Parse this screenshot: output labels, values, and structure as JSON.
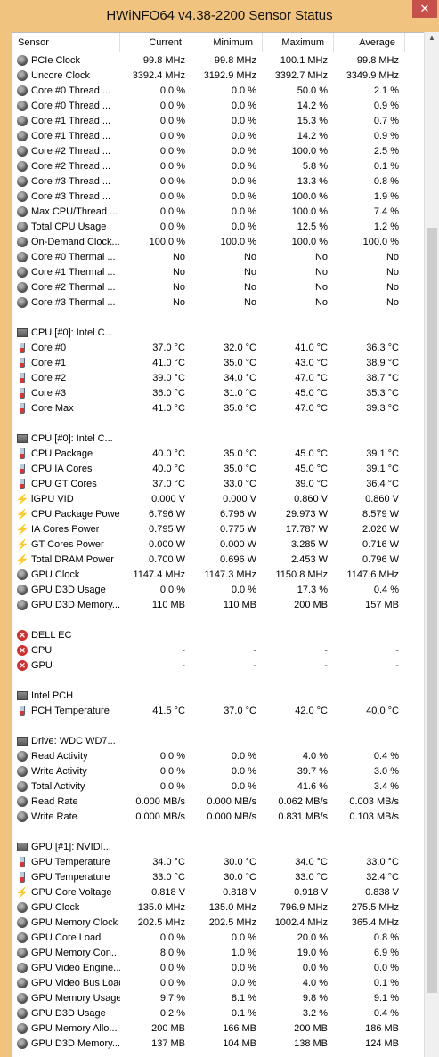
{
  "window": {
    "title": "HWiNFO64 v4.38-2200 Sensor Status",
    "close_label": "✕"
  },
  "columns": {
    "sensor": "Sensor",
    "current": "Current",
    "minimum": "Minimum",
    "maximum": "Maximum",
    "average": "Average"
  },
  "rows": [
    {
      "type": "row",
      "icon": "gauge",
      "name": "PCIe Clock",
      "cur": "99.8 MHz",
      "min": "99.8 MHz",
      "max": "100.1 MHz",
      "avg": "99.8 MHz"
    },
    {
      "type": "row",
      "icon": "gauge",
      "name": "Uncore Clock",
      "cur": "3392.4 MHz",
      "min": "3192.9 MHz",
      "max": "3392.7 MHz",
      "avg": "3349.9 MHz"
    },
    {
      "type": "row",
      "icon": "gauge",
      "name": "Core #0 Thread ...",
      "cur": "0.0 %",
      "min": "0.0 %",
      "max": "50.0 %",
      "avg": "2.1 %"
    },
    {
      "type": "row",
      "icon": "gauge",
      "name": "Core #0 Thread ...",
      "cur": "0.0 %",
      "min": "0.0 %",
      "max": "14.2 %",
      "avg": "0.9 %"
    },
    {
      "type": "row",
      "icon": "gauge",
      "name": "Core #1 Thread ...",
      "cur": "0.0 %",
      "min": "0.0 %",
      "max": "15.3 %",
      "avg": "0.7 %"
    },
    {
      "type": "row",
      "icon": "gauge",
      "name": "Core #1 Thread ...",
      "cur": "0.0 %",
      "min": "0.0 %",
      "max": "14.2 %",
      "avg": "0.9 %"
    },
    {
      "type": "row",
      "icon": "gauge",
      "name": "Core #2 Thread ...",
      "cur": "0.0 %",
      "min": "0.0 %",
      "max": "100.0 %",
      "avg": "2.5 %"
    },
    {
      "type": "row",
      "icon": "gauge",
      "name": "Core #2 Thread ...",
      "cur": "0.0 %",
      "min": "0.0 %",
      "max": "5.8 %",
      "avg": "0.1 %"
    },
    {
      "type": "row",
      "icon": "gauge",
      "name": "Core #3 Thread ...",
      "cur": "0.0 %",
      "min": "0.0 %",
      "max": "13.3 %",
      "avg": "0.8 %"
    },
    {
      "type": "row",
      "icon": "gauge",
      "name": "Core #3 Thread ...",
      "cur": "0.0 %",
      "min": "0.0 %",
      "max": "100.0 %",
      "avg": "1.9 %"
    },
    {
      "type": "row",
      "icon": "gauge",
      "name": "Max CPU/Thread ...",
      "cur": "0.0 %",
      "min": "0.0 %",
      "max": "100.0 %",
      "avg": "7.4 %"
    },
    {
      "type": "row",
      "icon": "gauge",
      "name": "Total CPU Usage",
      "cur": "0.0 %",
      "min": "0.0 %",
      "max": "12.5 %",
      "avg": "1.2 %"
    },
    {
      "type": "row",
      "icon": "gauge",
      "name": "On-Demand Clock...",
      "cur": "100.0 %",
      "min": "100.0 %",
      "max": "100.0 %",
      "avg": "100.0 %"
    },
    {
      "type": "row",
      "icon": "gauge",
      "name": "Core #0 Thermal ...",
      "cur": "No",
      "min": "No",
      "max": "No",
      "avg": "No"
    },
    {
      "type": "row",
      "icon": "gauge",
      "name": "Core #1 Thermal ...",
      "cur": "No",
      "min": "No",
      "max": "No",
      "avg": "No"
    },
    {
      "type": "row",
      "icon": "gauge",
      "name": "Core #2 Thermal ...",
      "cur": "No",
      "min": "No",
      "max": "No",
      "avg": "No"
    },
    {
      "type": "row",
      "icon": "gauge",
      "name": "Core #3 Thermal ...",
      "cur": "No",
      "min": "No",
      "max": "No",
      "avg": "No"
    },
    {
      "type": "spacer"
    },
    {
      "type": "group",
      "icon": "chip",
      "name": "CPU [#0]: Intel C..."
    },
    {
      "type": "row",
      "icon": "therm",
      "name": "Core #0",
      "cur": "37.0 °C",
      "min": "32.0 °C",
      "max": "41.0 °C",
      "avg": "36.3 °C"
    },
    {
      "type": "row",
      "icon": "therm",
      "name": "Core #1",
      "cur": "41.0 °C",
      "min": "35.0 °C",
      "max": "43.0 °C",
      "avg": "38.9 °C"
    },
    {
      "type": "row",
      "icon": "therm",
      "name": "Core #2",
      "cur": "39.0 °C",
      "min": "34.0 °C",
      "max": "47.0 °C",
      "avg": "38.7 °C"
    },
    {
      "type": "row",
      "icon": "therm",
      "name": "Core #3",
      "cur": "36.0 °C",
      "min": "31.0 °C",
      "max": "45.0 °C",
      "avg": "35.3 °C"
    },
    {
      "type": "row",
      "icon": "therm",
      "name": "Core Max",
      "cur": "41.0 °C",
      "min": "35.0 °C",
      "max": "47.0 °C",
      "avg": "39.3 °C"
    },
    {
      "type": "spacer"
    },
    {
      "type": "group",
      "icon": "chip",
      "name": "CPU [#0]: Intel C..."
    },
    {
      "type": "row",
      "icon": "therm",
      "name": "CPU Package",
      "cur": "40.0 °C",
      "min": "35.0 °C",
      "max": "45.0 °C",
      "avg": "39.1 °C"
    },
    {
      "type": "row",
      "icon": "therm",
      "name": "CPU IA Cores",
      "cur": "40.0 °C",
      "min": "35.0 °C",
      "max": "45.0 °C",
      "avg": "39.1 °C"
    },
    {
      "type": "row",
      "icon": "therm",
      "name": "CPU GT Cores",
      "cur": "37.0 °C",
      "min": "33.0 °C",
      "max": "39.0 °C",
      "avg": "36.4 °C"
    },
    {
      "type": "row",
      "icon": "bolt",
      "name": "iGPU VID",
      "cur": "0.000 V",
      "min": "0.000 V",
      "max": "0.860 V",
      "avg": "0.860 V"
    },
    {
      "type": "row",
      "icon": "bolt",
      "name": "CPU Package Power",
      "cur": "6.796 W",
      "min": "6.796 W",
      "max": "29.973 W",
      "avg": "8.579 W"
    },
    {
      "type": "row",
      "icon": "bolt",
      "name": "IA Cores Power",
      "cur": "0.795 W",
      "min": "0.775 W",
      "max": "17.787 W",
      "avg": "2.026 W"
    },
    {
      "type": "row",
      "icon": "bolt",
      "name": "GT Cores Power",
      "cur": "0.000 W",
      "min": "0.000 W",
      "max": "3.285 W",
      "avg": "0.716 W"
    },
    {
      "type": "row",
      "icon": "bolt",
      "name": "Total DRAM Power",
      "cur": "0.700 W",
      "min": "0.696 W",
      "max": "2.453 W",
      "avg": "0.796 W"
    },
    {
      "type": "row",
      "icon": "gauge",
      "name": "GPU Clock",
      "cur": "1147.4 MHz",
      "min": "1147.3 MHz",
      "max": "1150.8 MHz",
      "avg": "1147.6 MHz"
    },
    {
      "type": "row",
      "icon": "gauge",
      "name": "GPU D3D Usage",
      "cur": "0.0 %",
      "min": "0.0 %",
      "max": "17.3 %",
      "avg": "0.4 %"
    },
    {
      "type": "row",
      "icon": "gauge",
      "name": "GPU D3D Memory...",
      "cur": "110 MB",
      "min": "110 MB",
      "max": "200 MB",
      "avg": "157 MB"
    },
    {
      "type": "spacer"
    },
    {
      "type": "group",
      "icon": "err",
      "name": "DELL EC"
    },
    {
      "type": "row",
      "icon": "err",
      "name": "CPU",
      "cur": "-",
      "min": "-",
      "max": "-",
      "avg": "-"
    },
    {
      "type": "row",
      "icon": "err",
      "name": "GPU",
      "cur": "-",
      "min": "-",
      "max": "-",
      "avg": "-"
    },
    {
      "type": "spacer"
    },
    {
      "type": "group",
      "icon": "chip",
      "name": "Intel PCH"
    },
    {
      "type": "row",
      "icon": "therm",
      "name": "PCH Temperature",
      "cur": "41.5 °C",
      "min": "37.0 °C",
      "max": "42.0 °C",
      "avg": "40.0 °C"
    },
    {
      "type": "spacer"
    },
    {
      "type": "group",
      "icon": "chip",
      "name": "Drive: WDC WD7..."
    },
    {
      "type": "row",
      "icon": "gauge",
      "name": "Read Activity",
      "cur": "0.0 %",
      "min": "0.0 %",
      "max": "4.0 %",
      "avg": "0.4 %"
    },
    {
      "type": "row",
      "icon": "gauge",
      "name": "Write Activity",
      "cur": "0.0 %",
      "min": "0.0 %",
      "max": "39.7 %",
      "avg": "3.0 %"
    },
    {
      "type": "row",
      "icon": "gauge",
      "name": "Total Activity",
      "cur": "0.0 %",
      "min": "0.0 %",
      "max": "41.6 %",
      "avg": "3.4 %"
    },
    {
      "type": "row",
      "icon": "gauge",
      "name": "Read Rate",
      "cur": "0.000 MB/s",
      "min": "0.000 MB/s",
      "max": "0.062 MB/s",
      "avg": "0.003 MB/s"
    },
    {
      "type": "row",
      "icon": "gauge",
      "name": "Write Rate",
      "cur": "0.000 MB/s",
      "min": "0.000 MB/s",
      "max": "0.831 MB/s",
      "avg": "0.103 MB/s"
    },
    {
      "type": "spacer"
    },
    {
      "type": "group",
      "icon": "chip",
      "name": "GPU [#1]: NVIDI..."
    },
    {
      "type": "row",
      "icon": "therm",
      "name": "GPU Temperature",
      "cur": "34.0 °C",
      "min": "30.0 °C",
      "max": "34.0 °C",
      "avg": "33.0 °C"
    },
    {
      "type": "row",
      "icon": "therm",
      "name": "GPU Temperature",
      "cur": "33.0 °C",
      "min": "30.0 °C",
      "max": "33.0 °C",
      "avg": "32.4 °C"
    },
    {
      "type": "row",
      "icon": "bolt",
      "name": "GPU Core Voltage",
      "cur": "0.818 V",
      "min": "0.818 V",
      "max": "0.918 V",
      "avg": "0.838 V"
    },
    {
      "type": "row",
      "icon": "gauge",
      "name": "GPU Clock",
      "cur": "135.0 MHz",
      "min": "135.0 MHz",
      "max": "796.9 MHz",
      "avg": "275.5 MHz"
    },
    {
      "type": "row",
      "icon": "gauge",
      "name": "GPU Memory Clock",
      "cur": "202.5 MHz",
      "min": "202.5 MHz",
      "max": "1002.4 MHz",
      "avg": "365.4 MHz"
    },
    {
      "type": "row",
      "icon": "gauge",
      "name": "GPU Core Load",
      "cur": "0.0 %",
      "min": "0.0 %",
      "max": "20.0 %",
      "avg": "0.8 %"
    },
    {
      "type": "row",
      "icon": "gauge",
      "name": "GPU Memory Con...",
      "cur": "8.0 %",
      "min": "1.0 %",
      "max": "19.0 %",
      "avg": "6.9 %"
    },
    {
      "type": "row",
      "icon": "gauge",
      "name": "GPU Video Engine...",
      "cur": "0.0 %",
      "min": "0.0 %",
      "max": "0.0 %",
      "avg": "0.0 %"
    },
    {
      "type": "row",
      "icon": "gauge",
      "name": "GPU Video Bus Load",
      "cur": "0.0 %",
      "min": "0.0 %",
      "max": "4.0 %",
      "avg": "0.1 %"
    },
    {
      "type": "row",
      "icon": "gauge",
      "name": "GPU Memory Usage",
      "cur": "9.7 %",
      "min": "8.1 %",
      "max": "9.8 %",
      "avg": "9.1 %"
    },
    {
      "type": "row",
      "icon": "gauge",
      "name": "GPU D3D Usage",
      "cur": "0.2 %",
      "min": "0.1 %",
      "max": "3.2 %",
      "avg": "0.4 %"
    },
    {
      "type": "row",
      "icon": "gauge",
      "name": "GPU Memory Allo...",
      "cur": "200 MB",
      "min": "166 MB",
      "max": "200 MB",
      "avg": "186 MB"
    },
    {
      "type": "row",
      "icon": "gauge",
      "name": "GPU D3D Memory...",
      "cur": "137 MB",
      "min": "104 MB",
      "max": "138 MB",
      "avg": "124 MB"
    }
  ]
}
